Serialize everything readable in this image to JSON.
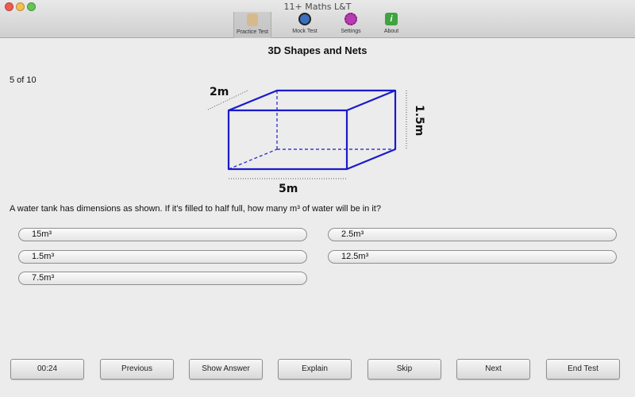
{
  "window": {
    "title": "11+ Maths L&T"
  },
  "toolbar": {
    "items": [
      {
        "label": "Practice Test",
        "icon": "clipboard-icon"
      },
      {
        "label": "Mock Test",
        "icon": "stopwatch-icon"
      },
      {
        "label": "Settings",
        "icon": "gear-icon"
      },
      {
        "label": "About",
        "icon": "info-icon"
      }
    ],
    "selected": "Practice Test"
  },
  "page": {
    "title": "3D Shapes and Nets",
    "progress": "5 of 10"
  },
  "figure": {
    "depth_label": "2m",
    "height_label": "1.5m",
    "width_label": "5m",
    "line_color": "#1a1acc"
  },
  "question": {
    "text": "A water tank has dimensions as shown. If it's filled to half full, how many m³ of water will be in it?",
    "answers": [
      "15m³",
      "2.5m³",
      "1.5m³",
      "12.5m³",
      "7.5m³"
    ]
  },
  "controls": {
    "timer": "00:24",
    "previous": "Previous",
    "show_answer": "Show Answer",
    "explain": "Explain",
    "skip": "Skip",
    "next": "Next",
    "end_test": "End Test"
  }
}
